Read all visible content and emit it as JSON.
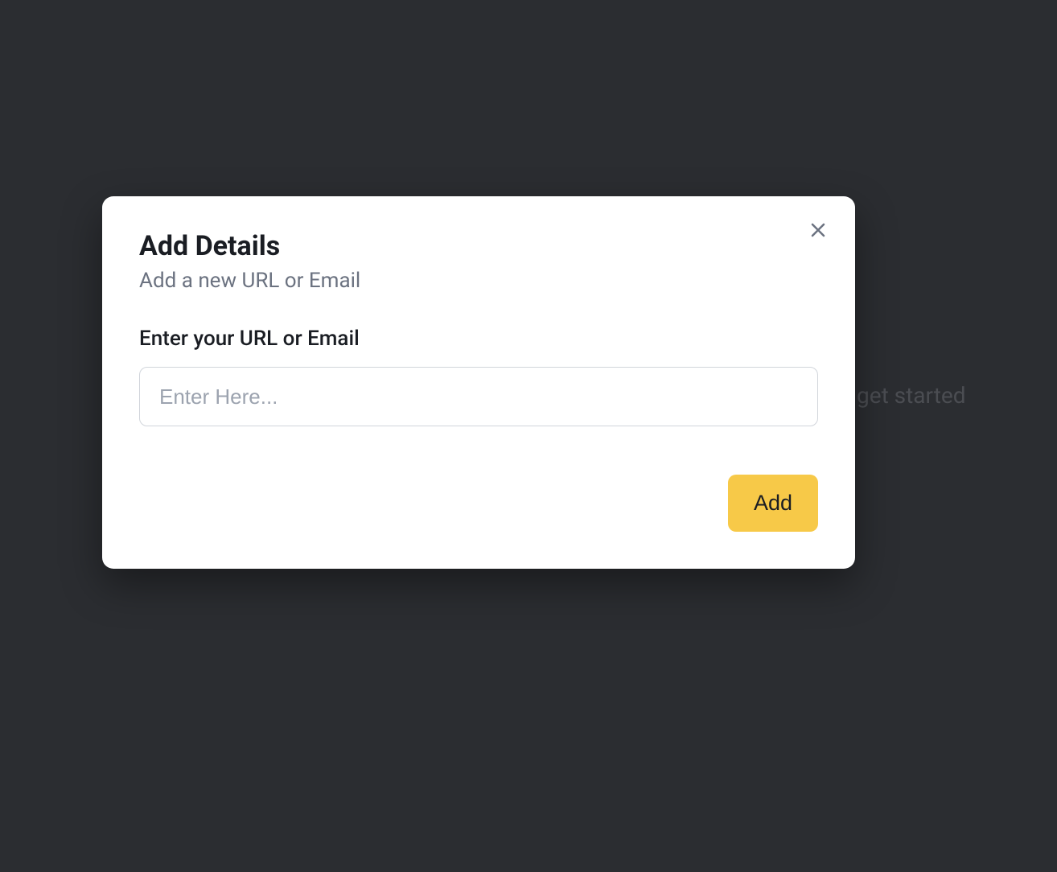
{
  "background": {
    "hint_text": "get started"
  },
  "modal": {
    "title": "Add Details",
    "subtitle": "Add a new URL or Email",
    "input_label": "Enter your URL or Email",
    "input_placeholder": "Enter Here...",
    "input_value": "",
    "add_button_label": "Add"
  }
}
